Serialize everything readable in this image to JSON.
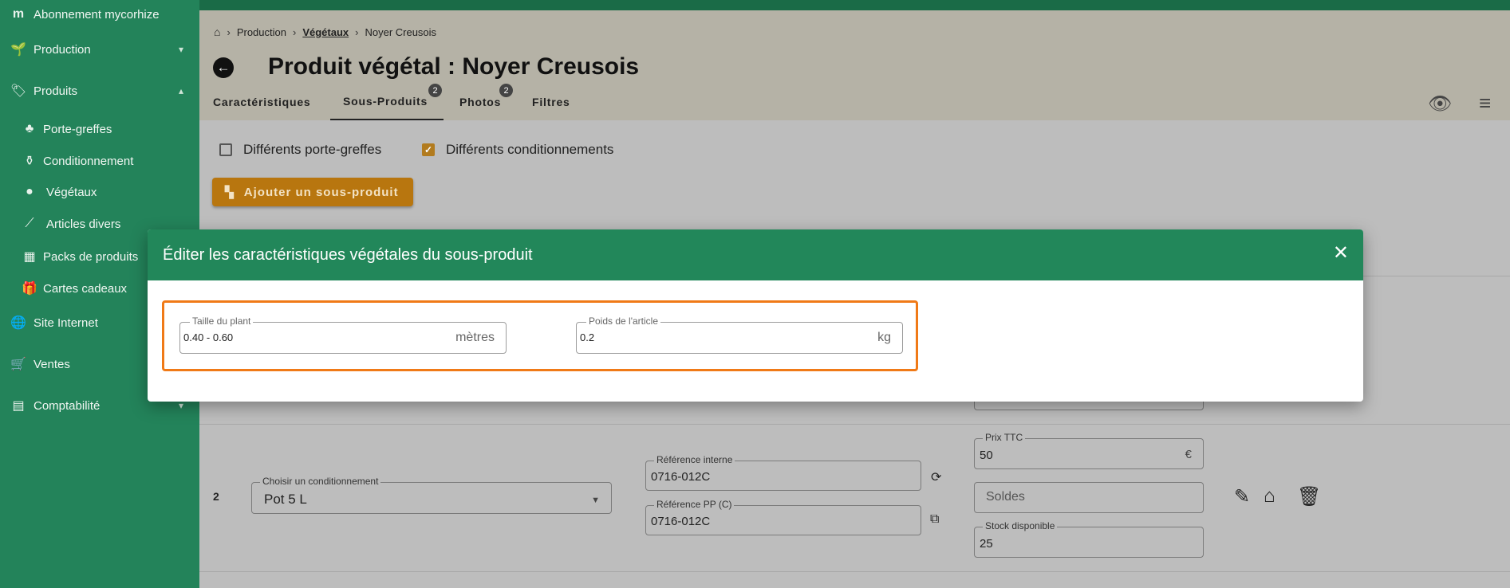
{
  "sidebar": {
    "brand": {
      "label": "Abonnement mycorhize",
      "icon": "mycorhize-logo-icon"
    },
    "items": [
      {
        "label": "Production",
        "icon": "sprout-icon",
        "chevron": "⌄"
      },
      {
        "label": "Produits",
        "icon": "tags-icon",
        "chevron": "⌃"
      },
      {
        "label": "Porte-greffes",
        "icon": "tree-icon"
      },
      {
        "label": "Conditionnement",
        "icon": "pot-icon"
      },
      {
        "label": "Végétaux",
        "icon": "leaf-icon"
      },
      {
        "label": "Articles divers",
        "icon": "broom-icon"
      },
      {
        "label": "Packs de produits",
        "icon": "grid-icon"
      },
      {
        "label": "Cartes cadeaux",
        "icon": "gift-icon"
      },
      {
        "label": "Site Internet",
        "icon": "globe-icon"
      },
      {
        "label": "Ventes",
        "icon": "cart-icon"
      },
      {
        "label": "Comptabilité",
        "icon": "calculator-icon",
        "chevron": "⌄"
      }
    ]
  },
  "breadcrumb": {
    "home_icon": "home-icon",
    "items": [
      "Production",
      "Végétaux",
      "Noyer Creusois"
    ]
  },
  "page": {
    "title": "Produit végétal : Noyer Creusois"
  },
  "tabs": [
    {
      "label": "Caractéristiques"
    },
    {
      "label": "Sous-Produits",
      "badge": "2"
    },
    {
      "label": "Photos",
      "badge": "2"
    },
    {
      "label": "Filtres"
    }
  ],
  "header_icons": {
    "view": "eye-icon",
    "menu": "menu-icon"
  },
  "options": {
    "porte_greffes": {
      "label": "Différents porte-greffes",
      "checked": false
    },
    "conditionnements": {
      "label": "Différents conditionnements",
      "checked": true
    }
  },
  "add_button": {
    "label": "Ajouter un sous-produit"
  },
  "row2": {
    "num": "2",
    "conditionnement": {
      "label": "Choisir un conditionnement",
      "value": "Pot 5 L"
    },
    "ref_interne": {
      "label": "Référence interne",
      "value": "0716-012C"
    },
    "ref_pp": {
      "label": "Référence PP (C)",
      "value": "0716-012C"
    },
    "prix": {
      "label": "Prix TTC",
      "value": "50",
      "suffix": "€"
    },
    "soldes": {
      "placeholder": "Soldes"
    },
    "stock": {
      "label": "Stock disponible",
      "value": "25"
    }
  },
  "modal": {
    "title": "Éditer les caractéristiques végétales du sous-produit",
    "taille": {
      "label": "Taille du plant",
      "value": "0.40 - 0.60",
      "suffix": "mètres"
    },
    "poids": {
      "label": "Poids de l'article",
      "value": "0.2",
      "suffix": "kg"
    }
  },
  "colors": {
    "sidebar": "#23835a",
    "accent": "#b8760f",
    "highlight": "#f07a17",
    "modal_header": "#22875a"
  }
}
